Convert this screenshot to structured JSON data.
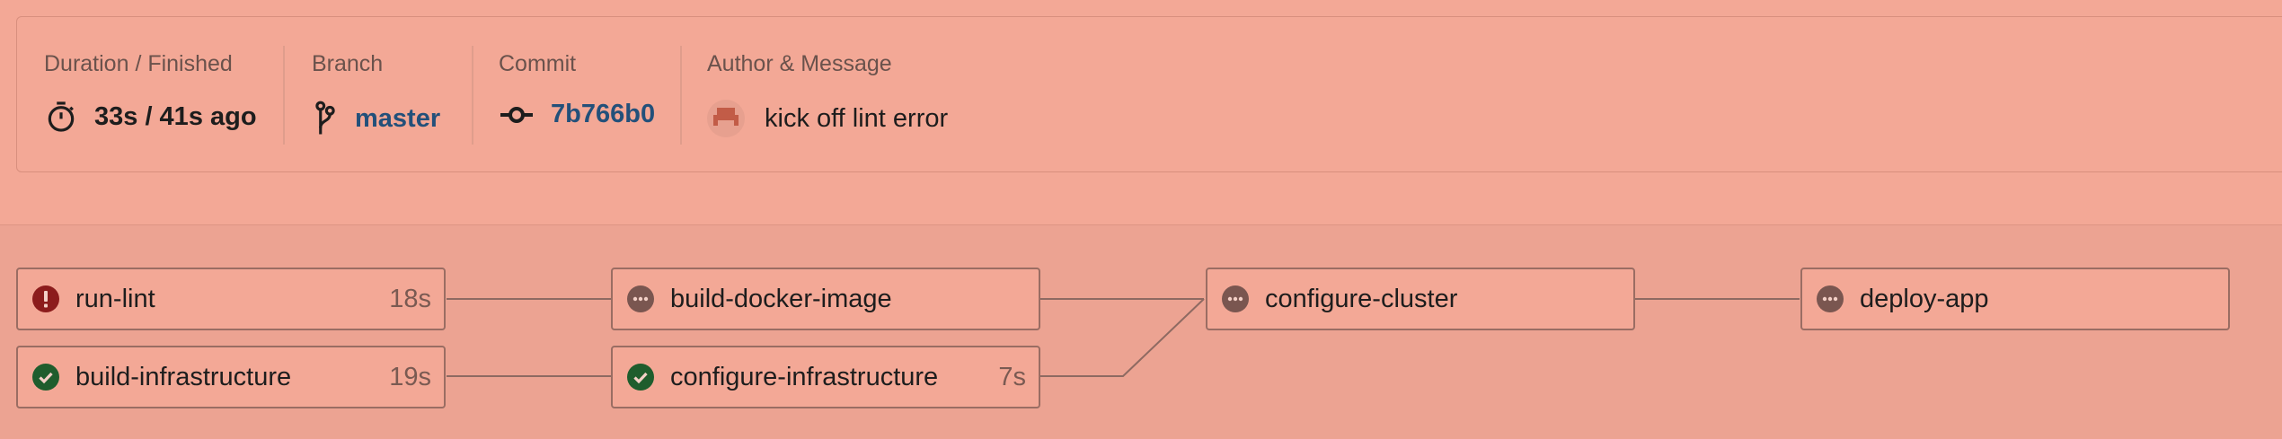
{
  "build_info": {
    "duration_label": "Duration / Finished",
    "duration_value": "33s / 41s ago",
    "branch_label": "Branch",
    "branch_value": "master",
    "commit_label": "Commit",
    "commit_value": "7b766b0",
    "author_label": "Author & Message",
    "message_value": "kick off lint error"
  },
  "jobs": [
    {
      "name": "run-lint",
      "duration": "18s",
      "status": "failed"
    },
    {
      "name": "build-infrastructure",
      "duration": "19s",
      "status": "success"
    },
    {
      "name": "build-docker-image",
      "duration": "",
      "status": "pending"
    },
    {
      "name": "configure-infrastructure",
      "duration": "7s",
      "status": "success"
    },
    {
      "name": "configure-cluster",
      "duration": "",
      "status": "pending"
    },
    {
      "name": "deploy-app",
      "duration": "",
      "status": "pending"
    }
  ],
  "colors": {
    "failed": "#8c1c1c",
    "success": "#1f5d2d",
    "pending": "#7a5650",
    "link": "#23507a"
  }
}
